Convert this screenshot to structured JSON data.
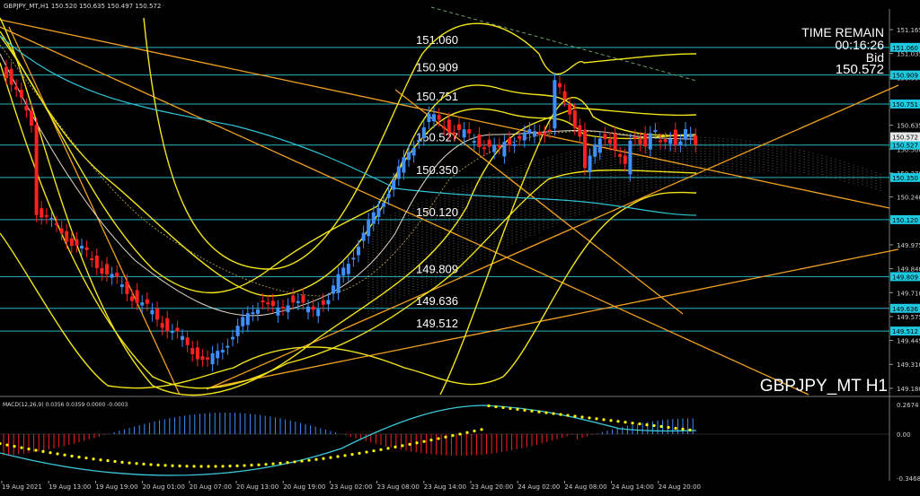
{
  "header": "GBPJPY_MT,H1  150.520 150.635 150.497 150.572",
  "symbol_label": "GBPJPY_MT H1",
  "info": {
    "time_remain_label": "TIME REMAIN",
    "time_remain": "00:16:26",
    "bid_label": "Bid",
    "bid": "150.572"
  },
  "levels": [
    {
      "label": "151.060",
      "tag": "151.060",
      "price": 151.06
    },
    {
      "label": "150.909",
      "tag": "150.909",
      "price": 150.909
    },
    {
      "label": "150.751",
      "tag": "150.751",
      "price": 150.751
    },
    {
      "label": "150.527",
      "tag": "150.527",
      "price": 150.527
    },
    {
      "label": "150.350",
      "tag": "150.350",
      "price": 150.35
    },
    {
      "label": "150.120",
      "tag": "150.120",
      "price": 150.12
    },
    {
      "label": "149.809",
      "tag": "149.809",
      "price": 149.809
    },
    {
      "label": "149.636",
      "tag": "149.636",
      "price": 149.636
    },
    {
      "label": "149.512",
      "tag": "149.512",
      "price": 149.512
    }
  ],
  "price_ticks": [
    "151.165",
    "151.035",
    "150.900",
    "150.765",
    "150.635",
    "150.500",
    "150.370",
    "150.240",
    "150.105",
    "149.975",
    "149.840",
    "149.710",
    "149.575",
    "149.445",
    "149.310",
    "149.180"
  ],
  "current_price": "150.572",
  "macd": {
    "label": "MACD(12,26,9) 0.0356 0.0359 0.0000 -0.0003",
    "ticks": [
      "0.2674",
      "0.00",
      "-0.3468"
    ]
  },
  "time_ticks": [
    "19 Aug 2021",
    "19 Aug 13:00",
    "19 Aug 19:00",
    "20 Aug 01:00",
    "20 Aug 07:00",
    "20 Aug 13:00",
    "20 Aug 19:00",
    "23 Aug 02:00",
    "23 Aug 08:00",
    "23 Aug 14:00",
    "23 Aug 20:00",
    "24 Aug 02:00",
    "24 Aug 08:00",
    "24 Aug 14:00",
    "24 Aug 20:00"
  ],
  "colors": {
    "bull": "#3f8fff",
    "bear": "#ff2020",
    "level_line": "#2ab3c4",
    "tag_bg": "#1ec8e0",
    "band": "#f2e41a",
    "trend": "#f0a020",
    "signal": "#ffff00",
    "macd_main": "#3cc8dc"
  }
}
